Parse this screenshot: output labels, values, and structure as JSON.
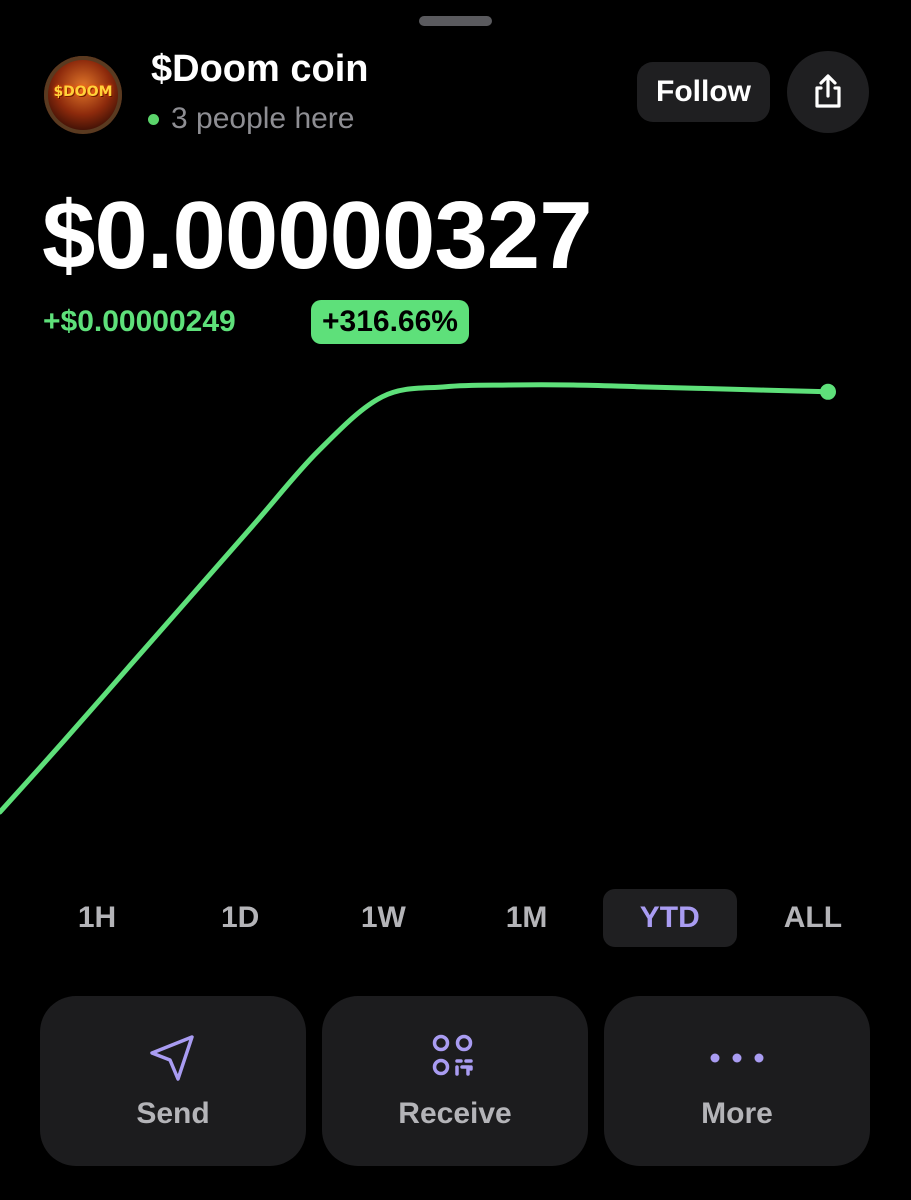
{
  "coin": {
    "name": "$Doom coin",
    "logo_text": "$DOOM",
    "presence_text": "3 people here"
  },
  "header": {
    "follow_label": "Follow",
    "share_icon": "share-icon"
  },
  "price": {
    "current": "$0.00000327",
    "change_abs": "+$0.00000249",
    "change_pct": "+316.66%"
  },
  "colors": {
    "background": "#000000",
    "positive": "#5ee07a",
    "accent": "#a99cf2",
    "surface": "#1c1c1e",
    "muted_text": "#8e8e93"
  },
  "chart_data": {
    "type": "line",
    "series": [
      {
        "values": [
          7.8e-07,
          1.2e-06,
          1.63e-06,
          2.06e-06,
          2.49e-06,
          2.92e-06,
          3.24e-06,
          3.3e-06,
          3.31e-06,
          3.31e-06,
          3.3e-06,
          3.29e-06,
          3.28e-06,
          3.27e-06
        ]
      }
    ],
    "grid": false,
    "end_marker": true
  },
  "time_ranges": {
    "items": [
      "1H",
      "1D",
      "1W",
      "1M",
      "YTD",
      "ALL"
    ],
    "selected": "YTD"
  },
  "actions": [
    {
      "label": "Send",
      "icon": "send-icon"
    },
    {
      "label": "Receive",
      "icon": "qr-code-icon"
    },
    {
      "label": "More",
      "icon": "more-dots-icon"
    }
  ]
}
